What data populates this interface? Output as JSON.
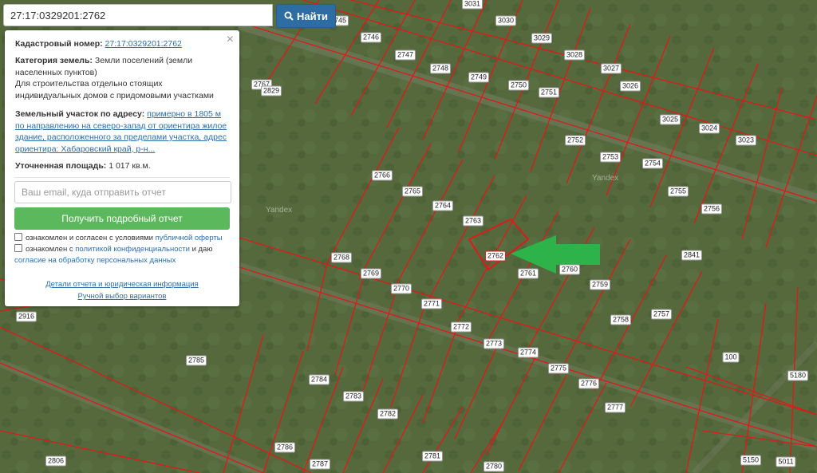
{
  "search": {
    "value": "27:17:0329201:2762",
    "button_label": "Найти"
  },
  "panel": {
    "cadastral_label": "Кадастровый номер:",
    "cadastral_number": "27:17:0329201:2762",
    "category_label": "Категория земель:",
    "category_value": "Земли поселений (земли населенных пунктов)",
    "usage_text": "Для строительства отдельно стоящих индивидуальных домов с придомовыми участками",
    "address_label": "Земельный участок по адресу:",
    "address_value": "примерно в 1805 м по направлению на северо-запад от ориентира жилое здание, расположенного за пределами участка, адрес ориентира: Хабаровский край, р-н...",
    "area_label": "Уточненная площадь:",
    "area_value": "1 017 кв.м.",
    "email_placeholder": "Ваш email, куда отправить отчет",
    "report_button": "Получить подробный отчет",
    "consent1_prefix": "ознакомлен и согласен с условиями",
    "consent1_link": "публичной оферты",
    "consent2_prefix": "ознакомлен с",
    "consent2_link1": "политикой конфиденциальности",
    "consent2_mid": "и даю",
    "consent2_link2": "согласие на обработку персональных данных",
    "details_link": "Детали отчета и юридическая информация",
    "manual_link": "Ручной выбор вариантов"
  },
  "map": {
    "watermark": "Yandex",
    "arrow_color": "#2db34a",
    "boundary_color": "#e01919",
    "selected_plot": "2762",
    "plots": [
      "2745",
      "2746",
      "2747",
      "2748",
      "2749",
      "2750",
      "2751",
      "2752",
      "2753",
      "2754",
      "2755",
      "2756",
      "3031",
      "3030",
      "3029",
      "3028",
      "3027",
      "3026",
      "3025",
      "3024",
      "3023",
      "2767",
      "2766",
      "2765",
      "2764",
      "2763",
      "2762",
      "2761",
      "2760",
      "2759",
      "2758",
      "2757",
      "2768",
      "2769",
      "2770",
      "2771",
      "2772",
      "2773",
      "2774",
      "2775",
      "2776",
      "2777",
      "2841",
      "2916",
      "2785",
      "2784",
      "2783",
      "2782",
      "2786",
      "2787",
      "2781",
      "2780",
      "2806",
      "100",
      "5180",
      "5150",
      "5011",
      "2829"
    ]
  }
}
